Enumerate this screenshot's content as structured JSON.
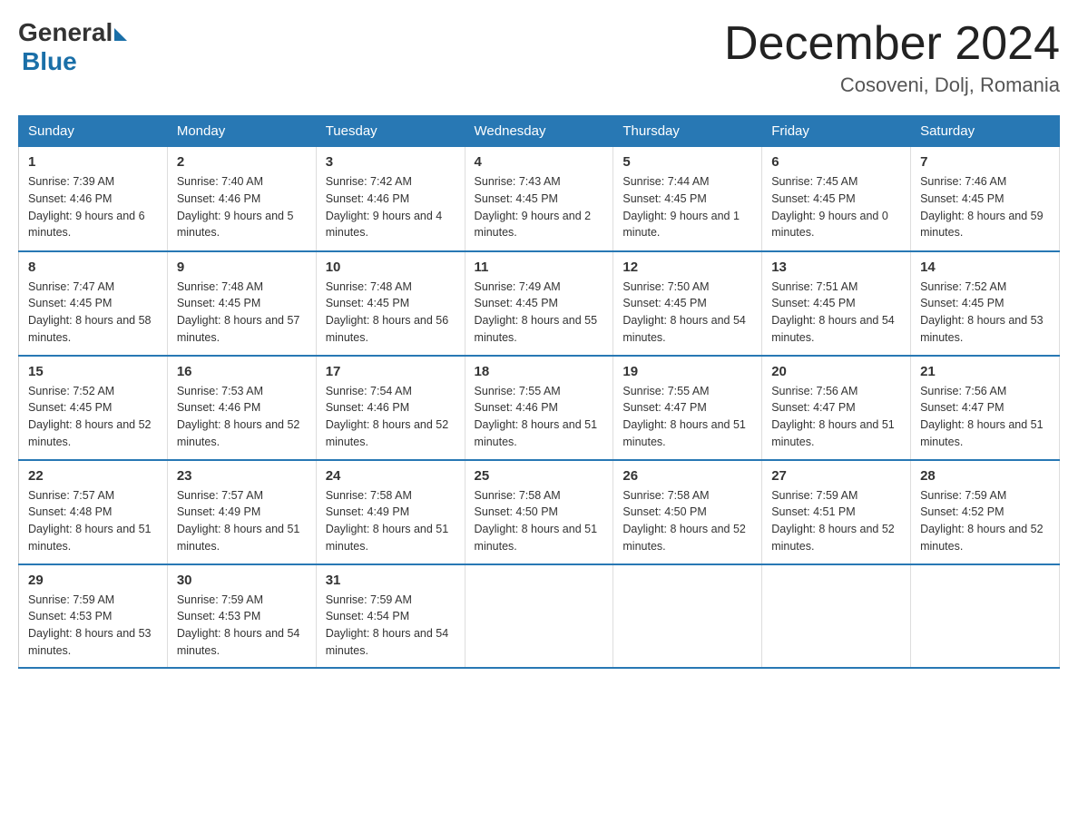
{
  "logo": {
    "general": "General",
    "blue": "Blue"
  },
  "title": "December 2024",
  "location": "Cosoveni, Dolj, Romania",
  "days_of_week": [
    "Sunday",
    "Monday",
    "Tuesday",
    "Wednesday",
    "Thursday",
    "Friday",
    "Saturday"
  ],
  "weeks": [
    [
      {
        "day": "1",
        "sunrise": "7:39 AM",
        "sunset": "4:46 PM",
        "daylight": "9 hours and 6 minutes."
      },
      {
        "day": "2",
        "sunrise": "7:40 AM",
        "sunset": "4:46 PM",
        "daylight": "9 hours and 5 minutes."
      },
      {
        "day": "3",
        "sunrise": "7:42 AM",
        "sunset": "4:46 PM",
        "daylight": "9 hours and 4 minutes."
      },
      {
        "day": "4",
        "sunrise": "7:43 AM",
        "sunset": "4:45 PM",
        "daylight": "9 hours and 2 minutes."
      },
      {
        "day": "5",
        "sunrise": "7:44 AM",
        "sunset": "4:45 PM",
        "daylight": "9 hours and 1 minute."
      },
      {
        "day": "6",
        "sunrise": "7:45 AM",
        "sunset": "4:45 PM",
        "daylight": "9 hours and 0 minutes."
      },
      {
        "day": "7",
        "sunrise": "7:46 AM",
        "sunset": "4:45 PM",
        "daylight": "8 hours and 59 minutes."
      }
    ],
    [
      {
        "day": "8",
        "sunrise": "7:47 AM",
        "sunset": "4:45 PM",
        "daylight": "8 hours and 58 minutes."
      },
      {
        "day": "9",
        "sunrise": "7:48 AM",
        "sunset": "4:45 PM",
        "daylight": "8 hours and 57 minutes."
      },
      {
        "day": "10",
        "sunrise": "7:48 AM",
        "sunset": "4:45 PM",
        "daylight": "8 hours and 56 minutes."
      },
      {
        "day": "11",
        "sunrise": "7:49 AM",
        "sunset": "4:45 PM",
        "daylight": "8 hours and 55 minutes."
      },
      {
        "day": "12",
        "sunrise": "7:50 AM",
        "sunset": "4:45 PM",
        "daylight": "8 hours and 54 minutes."
      },
      {
        "day": "13",
        "sunrise": "7:51 AM",
        "sunset": "4:45 PM",
        "daylight": "8 hours and 54 minutes."
      },
      {
        "day": "14",
        "sunrise": "7:52 AM",
        "sunset": "4:45 PM",
        "daylight": "8 hours and 53 minutes."
      }
    ],
    [
      {
        "day": "15",
        "sunrise": "7:52 AM",
        "sunset": "4:45 PM",
        "daylight": "8 hours and 52 minutes."
      },
      {
        "day": "16",
        "sunrise": "7:53 AM",
        "sunset": "4:46 PM",
        "daylight": "8 hours and 52 minutes."
      },
      {
        "day": "17",
        "sunrise": "7:54 AM",
        "sunset": "4:46 PM",
        "daylight": "8 hours and 52 minutes."
      },
      {
        "day": "18",
        "sunrise": "7:55 AM",
        "sunset": "4:46 PM",
        "daylight": "8 hours and 51 minutes."
      },
      {
        "day": "19",
        "sunrise": "7:55 AM",
        "sunset": "4:47 PM",
        "daylight": "8 hours and 51 minutes."
      },
      {
        "day": "20",
        "sunrise": "7:56 AM",
        "sunset": "4:47 PM",
        "daylight": "8 hours and 51 minutes."
      },
      {
        "day": "21",
        "sunrise": "7:56 AM",
        "sunset": "4:47 PM",
        "daylight": "8 hours and 51 minutes."
      }
    ],
    [
      {
        "day": "22",
        "sunrise": "7:57 AM",
        "sunset": "4:48 PM",
        "daylight": "8 hours and 51 minutes."
      },
      {
        "day": "23",
        "sunrise": "7:57 AM",
        "sunset": "4:49 PM",
        "daylight": "8 hours and 51 minutes."
      },
      {
        "day": "24",
        "sunrise": "7:58 AM",
        "sunset": "4:49 PM",
        "daylight": "8 hours and 51 minutes."
      },
      {
        "day": "25",
        "sunrise": "7:58 AM",
        "sunset": "4:50 PM",
        "daylight": "8 hours and 51 minutes."
      },
      {
        "day": "26",
        "sunrise": "7:58 AM",
        "sunset": "4:50 PM",
        "daylight": "8 hours and 52 minutes."
      },
      {
        "day": "27",
        "sunrise": "7:59 AM",
        "sunset": "4:51 PM",
        "daylight": "8 hours and 52 minutes."
      },
      {
        "day": "28",
        "sunrise": "7:59 AM",
        "sunset": "4:52 PM",
        "daylight": "8 hours and 52 minutes."
      }
    ],
    [
      {
        "day": "29",
        "sunrise": "7:59 AM",
        "sunset": "4:53 PM",
        "daylight": "8 hours and 53 minutes."
      },
      {
        "day": "30",
        "sunrise": "7:59 AM",
        "sunset": "4:53 PM",
        "daylight": "8 hours and 54 minutes."
      },
      {
        "day": "31",
        "sunrise": "7:59 AM",
        "sunset": "4:54 PM",
        "daylight": "8 hours and 54 minutes."
      },
      null,
      null,
      null,
      null
    ]
  ]
}
